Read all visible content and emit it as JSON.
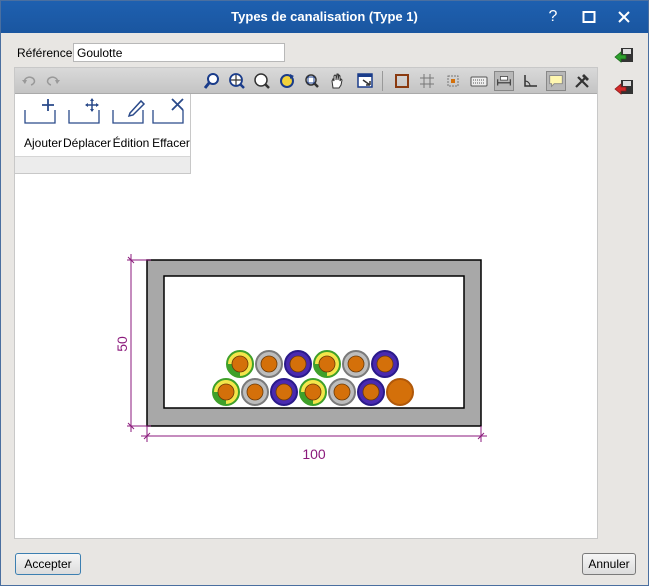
{
  "window": {
    "title": "Types de canalisation (Type 1)",
    "help_symbol": "?",
    "maximize_symbol": "☐",
    "close_symbol": "✕"
  },
  "reference": {
    "label": "Référence",
    "value": "Goulotte"
  },
  "edit_tools": [
    {
      "label": "Ajouter",
      "icon": "add-icon"
    },
    {
      "label": "Déplacer",
      "icon": "move-icon"
    },
    {
      "label": "Édition",
      "icon": "pencil-icon"
    },
    {
      "label": "Effacer",
      "icon": "delete-icon"
    }
  ],
  "toolbar_icons": [
    "undo-icon",
    "redo-icon",
    "zoom-fit-icon",
    "zoom-extents-icon",
    "zoom-x2-icon",
    "regenerate-icon",
    "zoom-window-icon",
    "pan-icon",
    "select-area-icon",
    "rectangle-icon",
    "grid-icon",
    "snap-icon",
    "keyboard-icon",
    "dimension-icon",
    "angle-icon",
    "comment-icon",
    "tools-icon"
  ],
  "drawing": {
    "dim_vertical": "50",
    "dim_horizontal": "100",
    "dim_color": "#8b1a7c",
    "duct_fill": "#a8a8a8",
    "cable_core": "#d4700a",
    "cable_colors": [
      "yellow-green",
      "grey",
      "blue"
    ]
  },
  "buttons": {
    "accept": "Accepter",
    "cancel": "Annuler"
  }
}
